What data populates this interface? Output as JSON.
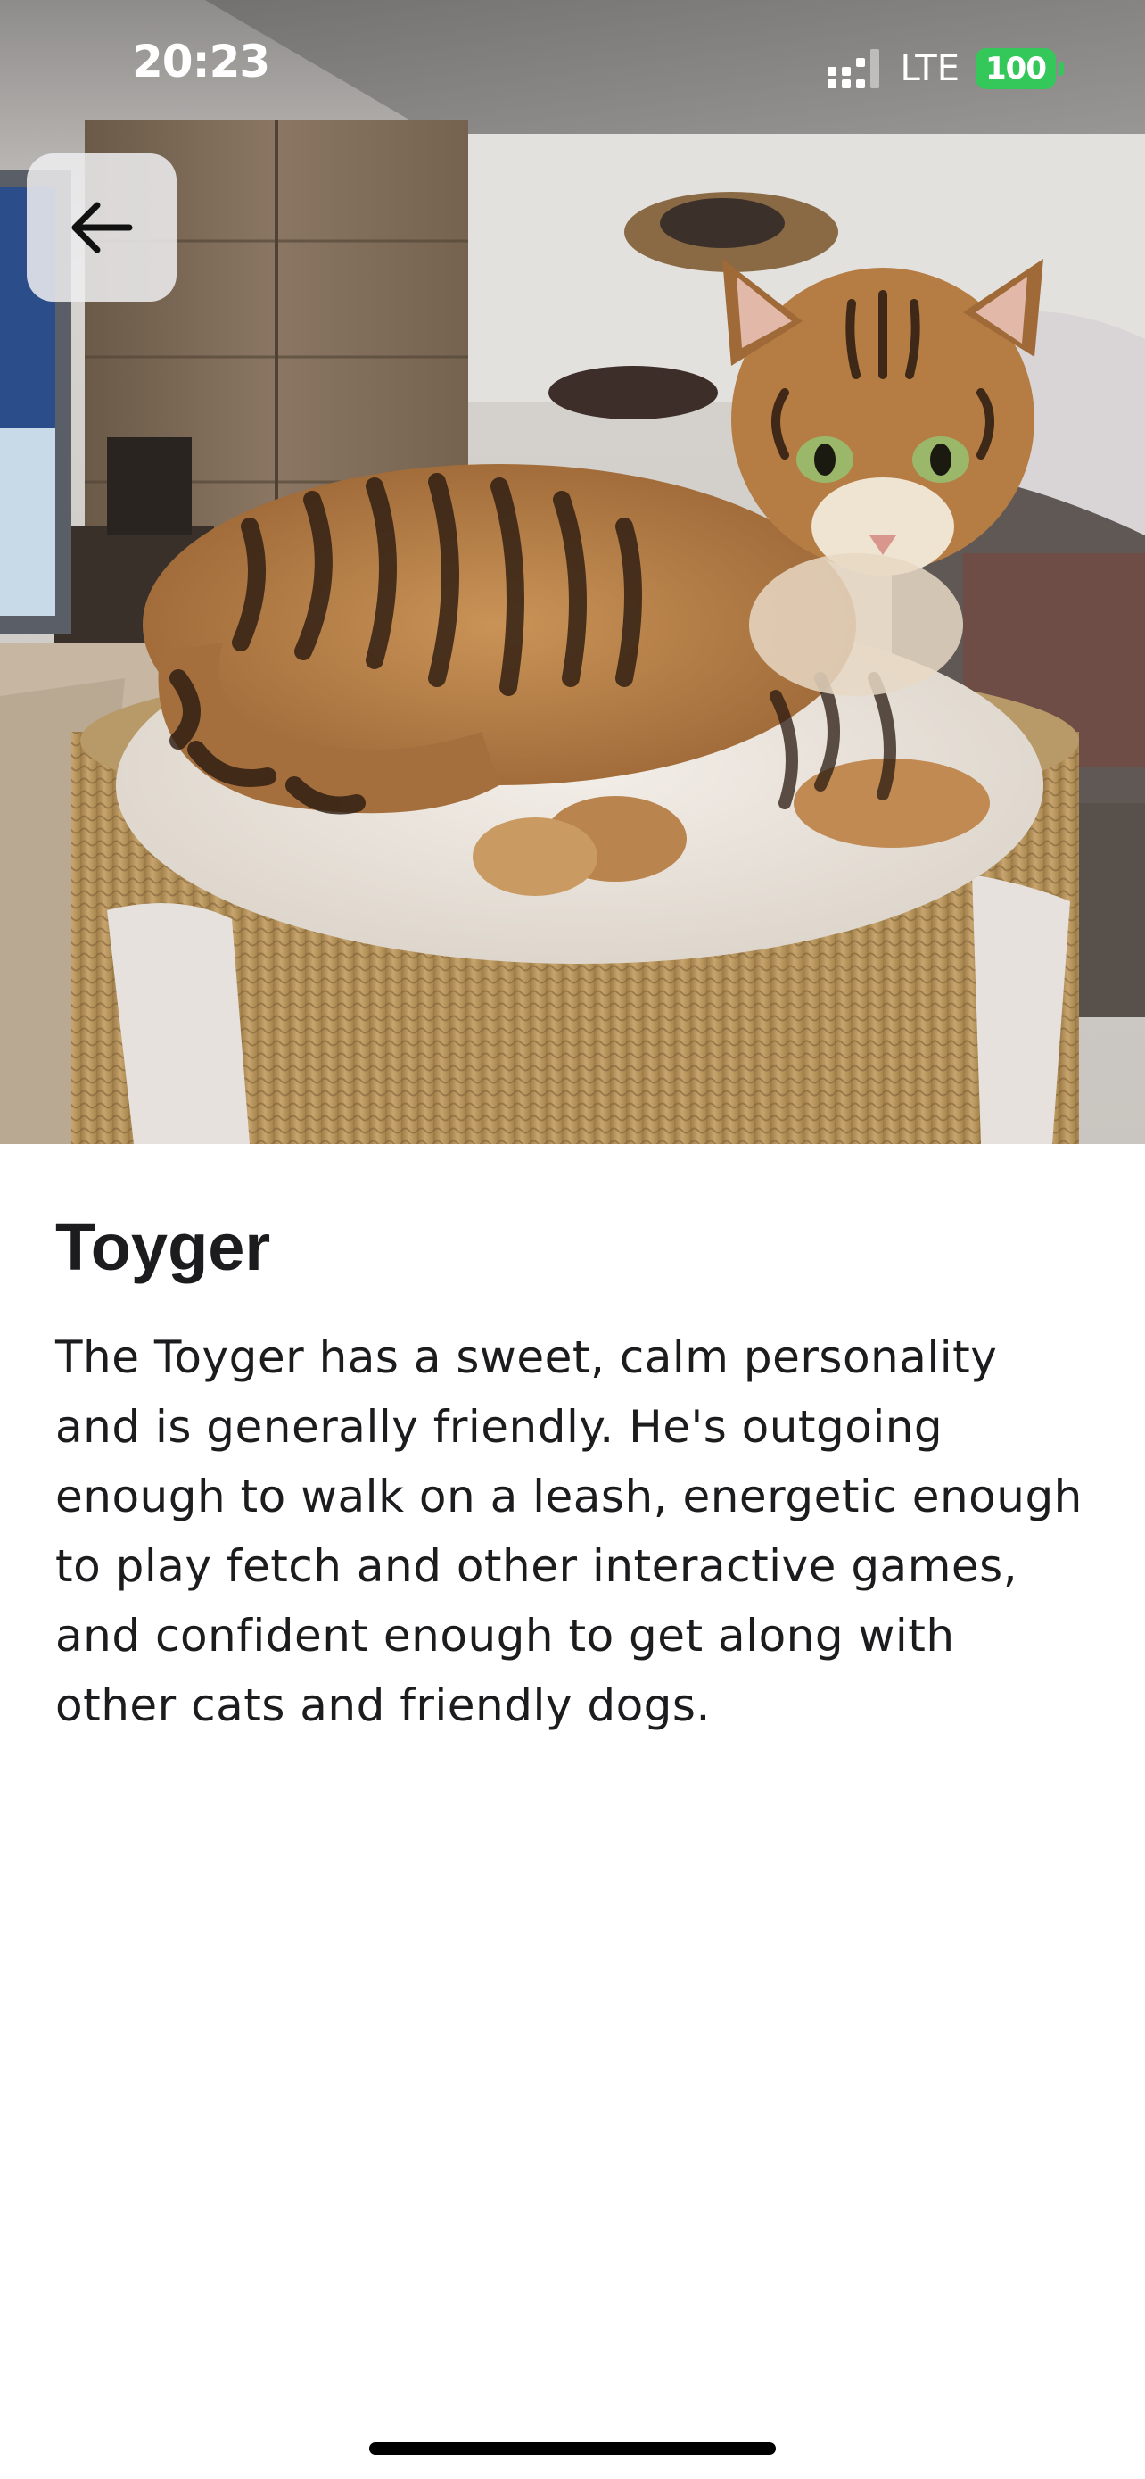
{
  "status_bar": {
    "time": "20:23",
    "network": "LTE",
    "battery": "100"
  },
  "hero": {
    "icon": "cat-photo",
    "back_icon": "arrow-left-icon"
  },
  "detail": {
    "title": "Toyger",
    "description": "The Toyger has a sweet, calm personality and is generally friendly. He's outgoing enough to walk on a leash, energetic enough to play fetch and other interactive games, and confident enough to get along with other cats and friendly dogs."
  },
  "colors": {
    "battery": "#34c759",
    "text": "#1c1c1e",
    "background": "#ffffff"
  }
}
